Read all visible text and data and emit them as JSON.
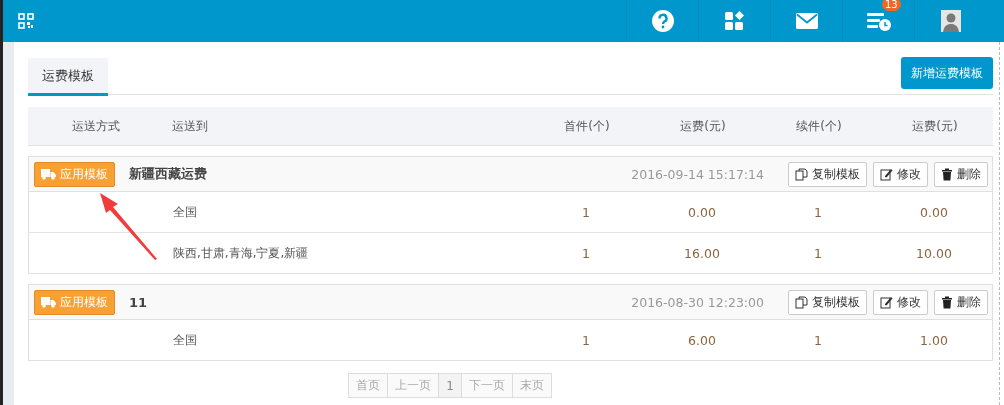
{
  "header": {
    "badge": "13"
  },
  "tabs": [
    {
      "label": "运费模板",
      "selected": true
    }
  ],
  "add_button": "新增运费模板",
  "table": {
    "columns": [
      "运送方式",
      "运送到",
      "首件(个)",
      "运费(元)",
      "续件(个)",
      "运费(元)"
    ]
  },
  "templates": [
    {
      "apply_button": "应用模板",
      "name": "新疆西藏运费",
      "date": "2016-09-14 15:17:14",
      "actions": [
        {
          "kind": "copy",
          "label": "复制模板"
        },
        {
          "kind": "edit",
          "label": "修改"
        },
        {
          "kind": "delete",
          "label": "删除"
        }
      ],
      "rows": [
        {
          "destination": "全国",
          "first_qty": "1",
          "first_fee": "0.00",
          "extra_qty": "1",
          "extra_fee": "0.00"
        },
        {
          "destination": "陕西,甘肃,青海,宁夏,新疆",
          "first_qty": "1",
          "first_fee": "16.00",
          "extra_qty": "1",
          "extra_fee": "10.00"
        }
      ]
    },
    {
      "apply_button": "应用模板",
      "name": "11",
      "date": "2016-08-30 12:23:00",
      "actions": [
        {
          "kind": "copy",
          "label": "复制模板"
        },
        {
          "kind": "edit",
          "label": "修改"
        },
        {
          "kind": "delete",
          "label": "删除"
        }
      ],
      "rows": [
        {
          "destination": "全国",
          "first_qty": "1",
          "first_fee": "6.00",
          "extra_qty": "1",
          "extra_fee": "1.00"
        }
      ]
    }
  ],
  "pagination": [
    {
      "label": "首页",
      "selected": false
    },
    {
      "label": "上一页",
      "selected": false
    },
    {
      "label": "1",
      "selected": true
    },
    {
      "label": "下一页",
      "selected": false
    },
    {
      "label": "末页",
      "selected": false
    }
  ]
}
